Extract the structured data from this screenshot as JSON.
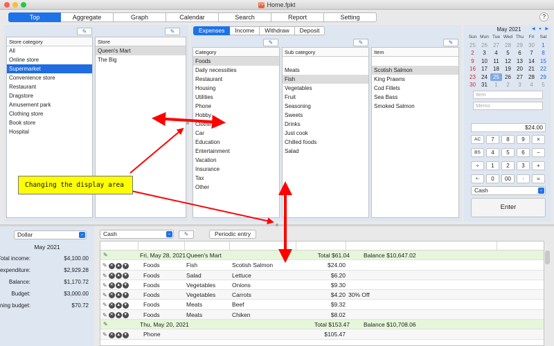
{
  "window": {
    "title": "Home.fpkt",
    "app_icon": "FP"
  },
  "tabs": [
    "Top",
    "Aggregate",
    "Graph",
    "Calendar",
    "Search",
    "Report",
    "Setting"
  ],
  "help_label": "?",
  "store_category": {
    "header": "Store category",
    "items": [
      "All",
      "Online store",
      "Supermarket",
      "Convenience store",
      "Restaurant",
      "Dragstore",
      "Amusement park",
      "Clothing store",
      "Book store",
      "Hospital"
    ],
    "selected": 2
  },
  "store": {
    "header": "Store",
    "items": [
      "Queen's Mart",
      "The Big"
    ],
    "selected": 0
  },
  "entry_tabs": [
    "Expenses",
    "Income",
    "Withdraw",
    "Deposit"
  ],
  "category": {
    "header": "Category",
    "items": [
      "Foods",
      "Daily necessities",
      "Restaurant",
      "Housing",
      "Utilities",
      "Phone",
      "Hobby",
      "Clothing",
      "Car",
      "Education",
      "Entertainment",
      "Vacation",
      "Insurance",
      "Tax",
      "Other"
    ],
    "selected": 0
  },
  "sub_category": {
    "header": "Sub category",
    "items": [
      "Meats",
      "Fish",
      "Vegetables",
      "Fruit",
      "Seasoning",
      "Sweets",
      "Drinks",
      "Just cook",
      "Chilled foods",
      "Salad"
    ],
    "selected": 1
  },
  "item": {
    "header": "Item",
    "items": [
      "Scotish Salmon",
      "King Prawns",
      "Cod Fillets",
      "Sea Bass",
      "Smoked Salmon"
    ],
    "selected": 0
  },
  "calendar": {
    "title": "May 2021",
    "nav": "◀ ● ▶",
    "weekdays": [
      "Sun",
      "Mon",
      "Tue",
      "Wed",
      "Thu",
      "Fri",
      "Sat"
    ],
    "days": [
      {
        "d": "25",
        "o": true
      },
      {
        "d": "26",
        "o": true
      },
      {
        "d": "27",
        "o": true
      },
      {
        "d": "28",
        "o": true
      },
      {
        "d": "29",
        "o": true
      },
      {
        "d": "30",
        "o": true
      },
      {
        "d": "1"
      },
      {
        "d": "2"
      },
      {
        "d": "3"
      },
      {
        "d": "4"
      },
      {
        "d": "5"
      },
      {
        "d": "6"
      },
      {
        "d": "7"
      },
      {
        "d": "8"
      },
      {
        "d": "9"
      },
      {
        "d": "10"
      },
      {
        "d": "11"
      },
      {
        "d": "12"
      },
      {
        "d": "13"
      },
      {
        "d": "14"
      },
      {
        "d": "15"
      },
      {
        "d": "16"
      },
      {
        "d": "17"
      },
      {
        "d": "18"
      },
      {
        "d": "19"
      },
      {
        "d": "20"
      },
      {
        "d": "21"
      },
      {
        "d": "22"
      },
      {
        "d": "23"
      },
      {
        "d": "24"
      },
      {
        "d": "25",
        "t": true
      },
      {
        "d": "26"
      },
      {
        "d": "27"
      },
      {
        "d": "28"
      },
      {
        "d": "29"
      },
      {
        "d": "30"
      },
      {
        "d": "31"
      },
      {
        "d": "1",
        "o": true
      },
      {
        "d": "2",
        "o": true
      },
      {
        "d": "3",
        "o": true
      },
      {
        "d": "4",
        "o": true
      },
      {
        "d": "5",
        "o": true
      }
    ]
  },
  "inputs": {
    "item_placeholder": "Item",
    "memo_placeholder": "Memo"
  },
  "amount": "$24.00",
  "keypad": [
    [
      "AC",
      "7",
      "8",
      "9",
      "×"
    ],
    [
      "BS",
      "4",
      "5",
      "6",
      "−"
    ],
    [
      "÷",
      "1",
      "2",
      "3",
      "+"
    ],
    [
      "+-",
      "0",
      "00",
      "·",
      "="
    ]
  ],
  "payment": "Cash",
  "enter_label": "Enter",
  "summary": {
    "currency": "Dollar",
    "month": "May 2021",
    "rows": [
      {
        "label": "Total income:",
        "value": "$4,100.00"
      },
      {
        "label": "Total expenditure:",
        "value": "$2,929.28"
      },
      {
        "label": "Balance:",
        "value": "$1,170.72"
      },
      {
        "label": "Budget:",
        "value": "$3,000.00"
      },
      {
        "label": "Remaining budget:",
        "value": "$70.72"
      }
    ]
  },
  "account": "Cash",
  "periodic_label": "Periodic entry",
  "transactions": [
    {
      "group": true,
      "date": "Fri, May 28, 2021",
      "store": "Queen's Mart",
      "total": "Total $61.04",
      "balance": "Balance $10,647.02"
    },
    {
      "cat": "Foods",
      "sub": "Fish",
      "item": "Scotish Salmon",
      "amount": "$24.00",
      "memo": ""
    },
    {
      "cat": "Foods",
      "sub": "Salad",
      "item": "Lettuce",
      "amount": "$6.20",
      "memo": ""
    },
    {
      "cat": "Foods",
      "sub": "Vegetables",
      "item": "Onions",
      "amount": "$9.30",
      "memo": ""
    },
    {
      "cat": "Foods",
      "sub": "Vegetables",
      "item": "Carrots",
      "amount": "$4.20",
      "memo": "30% Off"
    },
    {
      "cat": "Foods",
      "sub": "Meats",
      "item": "Beef",
      "amount": "$9.32",
      "memo": ""
    },
    {
      "cat": "Foods",
      "sub": "Meats",
      "item": "Chiken",
      "amount": "$8.02",
      "memo": ""
    },
    {
      "group": true,
      "date": "Thu, May 20, 2021",
      "store": "",
      "total": "Total $153.47",
      "balance": "Balance $10,708.06"
    },
    {
      "cat": "Phone",
      "sub": "",
      "item": "",
      "amount": "$105.47",
      "memo": ""
    }
  ],
  "callout": "Changing the display area",
  "colors": {
    "accent": "#1e72e8",
    "annotation_arrow": "#ff0000",
    "callout_bg": "#fdfd06"
  }
}
